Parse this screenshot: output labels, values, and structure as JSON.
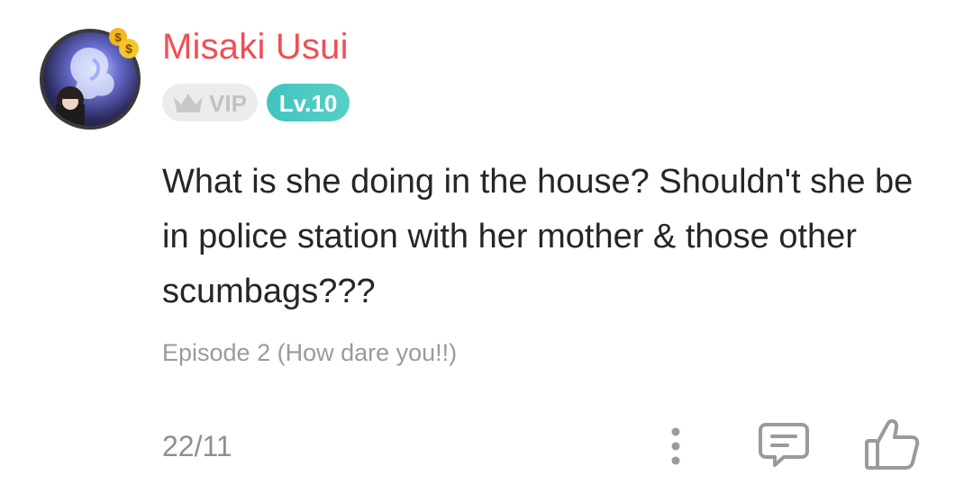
{
  "comment": {
    "user": {
      "name": "Misaki Usui",
      "vip_label": "VIP",
      "level_label": "Lv.10"
    },
    "text": "What is she doing in the house? Shouldn't she be in police station with her mother & those other scumbags???",
    "episode": "Episode 2 (How dare you!!)",
    "date": "22/11"
  },
  "icons": {
    "avatar_badge": "money-bag-icon",
    "vip": "crown-icon",
    "more": "more-vertical-icon",
    "reply": "comment-icon",
    "like": "thumbs-up-icon"
  },
  "colors": {
    "username": "#ef4f55",
    "level_badge": "#4ac8c3",
    "vip_badge_bg": "#ececec",
    "text": "#262626",
    "muted": "#9a9a9a"
  }
}
